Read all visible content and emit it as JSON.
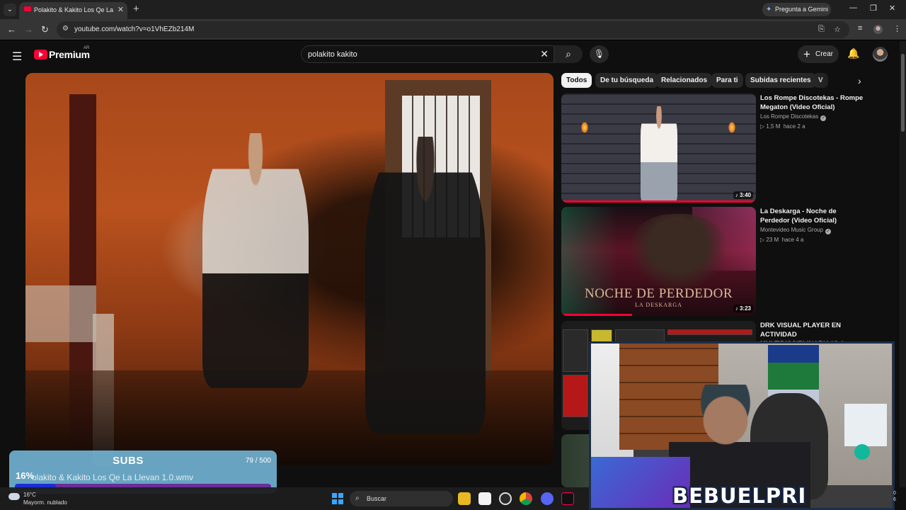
{
  "browser": {
    "tab_title": "Polakito & Kakito Los Qe La Llev",
    "url": "youtube.com/watch?v=o1VhEZb214M",
    "gemini_label": "Pregunta a Gemini"
  },
  "masthead": {
    "logo_text": "Premium",
    "country_code": "AR",
    "search_query": "polakito kakito",
    "create_label": "Crear"
  },
  "chips": [
    "Todos",
    "De tu búsqueda",
    "Relacionados",
    "Para ti",
    "Subidas recientes",
    "V"
  ],
  "recommendations": [
    {
      "title": "Los Rompe Discotekas - Rompe Megaton (Video Oficial)",
      "channel": "Los Rompe Discotekas",
      "views": "1,5 M",
      "age": "hace 2 a",
      "duration": "3:40"
    },
    {
      "title": "La Deskarga -  Noche de Perdedor (Video Oficial)",
      "channel": "Montevideo Music Group",
      "views": "23 M",
      "age": "hace 4 a",
      "duration": "3:23",
      "thumb_text_big": "NOCHE DE PERDEDOR",
      "thumb_text_small": "LA DESKARGA"
    },
    {
      "title": "DRK VISUAL PLAYER EN ACTIVIDAD MULTIDISCIPLINARIA Viviana",
      "channel": "",
      "views": "",
      "age": ""
    }
  ],
  "overlay": {
    "subs_label": "SUBS",
    "subs_count": "79 / 500",
    "subs_percent": "16%",
    "subs_progress": 0.16,
    "now_playing": "olakito & Kakito Los Qe La Llevan 1.0.wmv",
    "streamer_name": "BEBUELPRI"
  },
  "taskbar": {
    "weather_temp": "16°C",
    "weather_desc": "Mayorm. nublado",
    "search_label": "Buscar",
    "tray_line1": "0",
    "tray_line2": "6"
  },
  "colors": {
    "yt_red": "#ff0033",
    "page_bg": "#0f0f0f",
    "chip_bg": "#272727",
    "subs_bg": "#78bee1",
    "subs_fill": "#1b2dd6"
  }
}
